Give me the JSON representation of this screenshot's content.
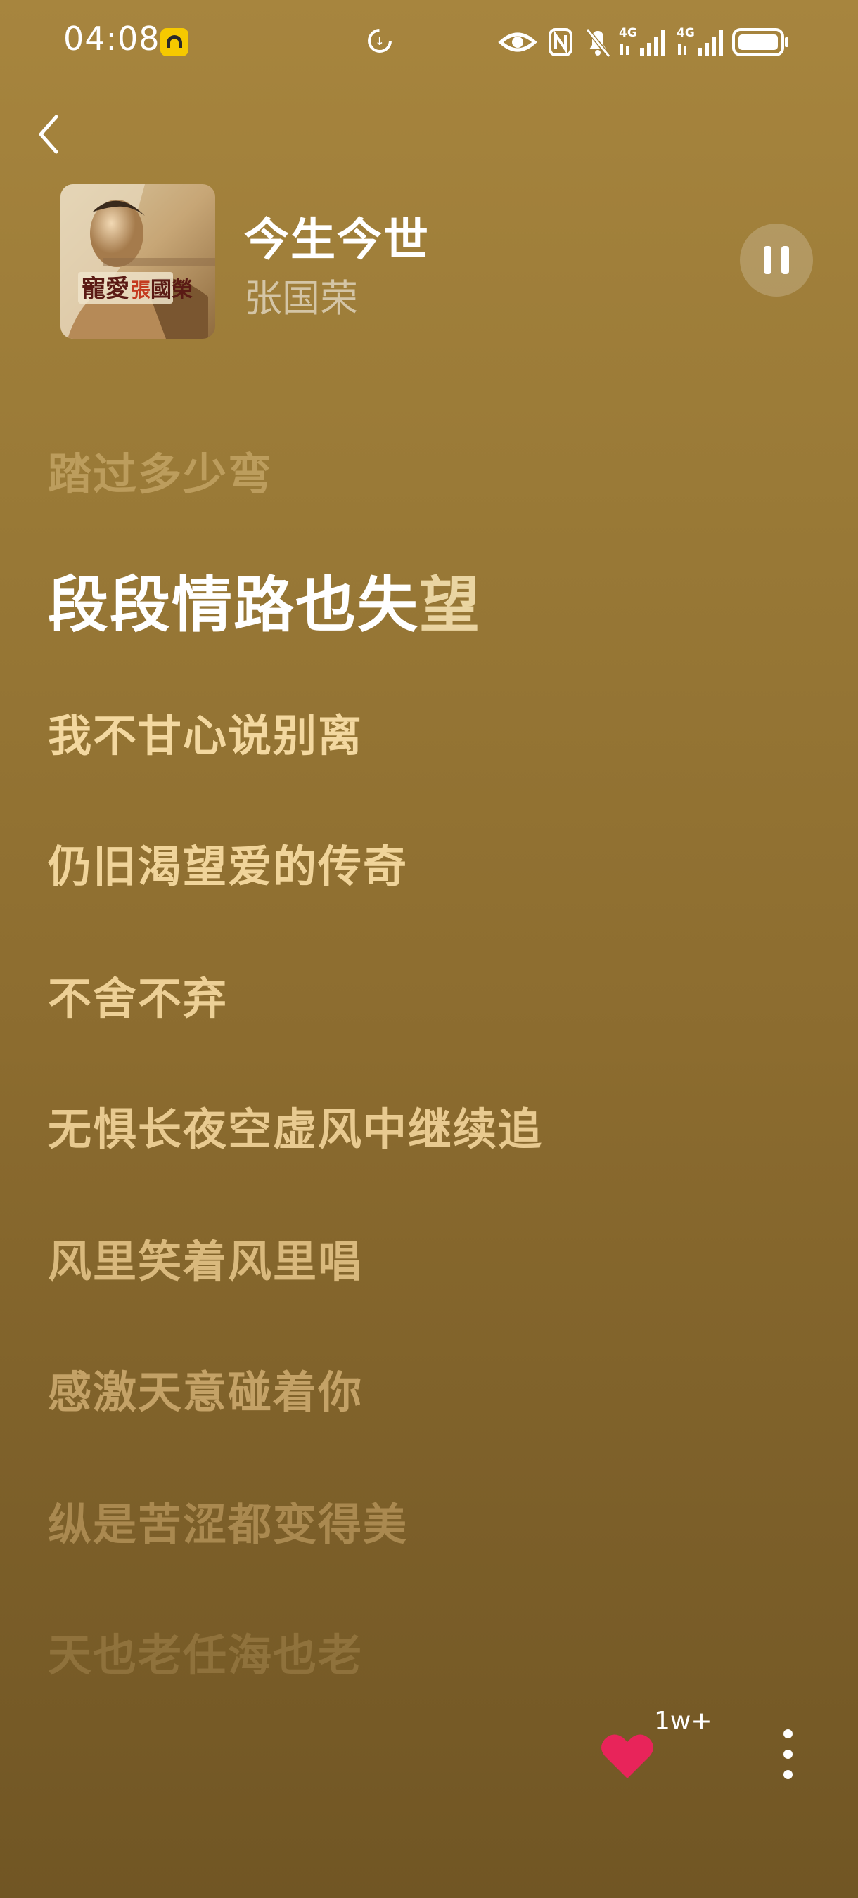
{
  "status_bar": {
    "time": "04:08",
    "icons": [
      "app-notification-icon",
      "data-saver-icon",
      "eye-icon",
      "nfc-icon",
      "mute-bell-icon",
      "signal-4g-icon",
      "signal-4g-icon",
      "battery-icon"
    ],
    "signal_label_1": "4G",
    "signal_label_2": "4G"
  },
  "player": {
    "title": "今生今世",
    "artist": "张国荣",
    "state": "playing"
  },
  "lyrics": {
    "previous": "踏过多少弯",
    "current_sung": "段段情路也失",
    "current_rest": "望",
    "upcoming": [
      "我不甘心说别离",
      "仍旧渴望爱的传奇",
      "不舍不弃",
      "无惧长夜空虚风中继续追",
      "风里笑着风里唱",
      "感激天意碰着你",
      "纵是苦涩都变得美",
      "天也老任海也老"
    ]
  },
  "actions": {
    "like_count": "1w+"
  },
  "colors": {
    "background_top": "#a7853e",
    "background_bottom": "#715624",
    "like_heart": "#e8245a",
    "lyric_upcoming": "#f3d8a0"
  }
}
